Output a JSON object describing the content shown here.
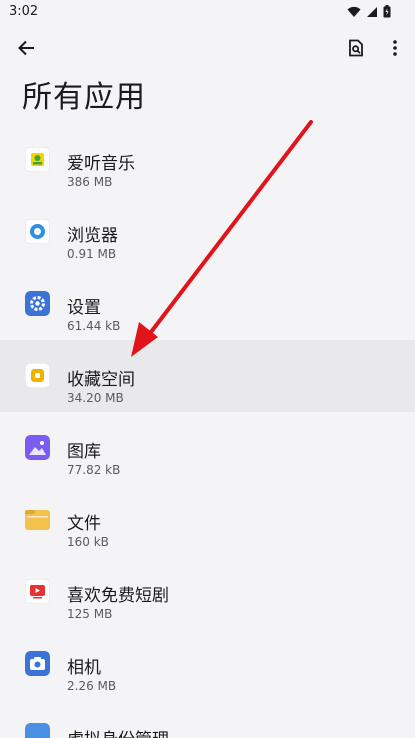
{
  "status_bar": {
    "time": "3:02"
  },
  "page": {
    "title": "所有应用"
  },
  "apps": [
    {
      "name": "爱听音乐",
      "size": "386 MB"
    },
    {
      "name": "浏览器",
      "size": "0.91 MB"
    },
    {
      "name": "设置",
      "size": "61.44 kB"
    },
    {
      "name": "收藏空间",
      "size": "34.20 MB"
    },
    {
      "name": "图库",
      "size": "77.82 kB"
    },
    {
      "name": "文件",
      "size": "160 kB"
    },
    {
      "name": "喜欢免费短剧",
      "size": "125 MB"
    },
    {
      "name": "相机",
      "size": "2.26 MB"
    },
    {
      "name": "虚拟身份管理",
      "size": ""
    }
  ],
  "colors": {
    "arrow": "#e3131b",
    "highlight": "#e9e9ec",
    "settings_icon": "#3b74d6",
    "gallery_icon": "#7a5cf0",
    "files_icon": "#f2c14e"
  }
}
